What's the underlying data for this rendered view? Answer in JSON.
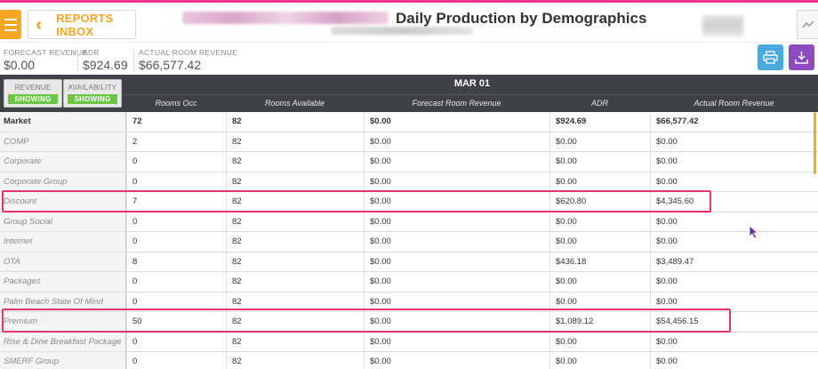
{
  "header": {
    "inbox_label": "REPORTS INBOX",
    "title": "Daily Production by Demographics"
  },
  "summary": {
    "stats": [
      {
        "label": "FORECAST REVENUE",
        "value": "$0.00"
      },
      {
        "label": "ADR",
        "value": "$924.69"
      },
      {
        "label": "ACTUAL ROOM REVENUE",
        "value": "$66,577.42"
      }
    ]
  },
  "toggles": [
    {
      "title": "REVENUE",
      "state": "SHOWING"
    },
    {
      "title": "AVAILABILITY",
      "state": "SHOWING"
    }
  ],
  "table": {
    "date": "MAR 01",
    "columns": [
      "Rooms Occ",
      "Rooms Available",
      "Forecast Room Revenue",
      "ADR",
      "Actual Room Revenue"
    ],
    "rows": [
      {
        "label": "Market",
        "values": [
          "72",
          "82",
          "$0.00",
          "$924.69",
          "$66,577.42"
        ]
      },
      {
        "label": "COMP",
        "values": [
          "2",
          "82",
          "$0.00",
          "$0.00",
          "$0.00"
        ]
      },
      {
        "label": "Corporate",
        "values": [
          "0",
          "82",
          "$0.00",
          "$0.00",
          "$0.00"
        ]
      },
      {
        "label": "Corporate Group",
        "values": [
          "0",
          "82",
          "$0.00",
          "$0.00",
          "$0.00"
        ]
      },
      {
        "label": "Discount",
        "values": [
          "7",
          "82",
          "$0.00",
          "$620.80",
          "$4,345.60"
        ]
      },
      {
        "label": "Group Social",
        "values": [
          "0",
          "82",
          "$0.00",
          "$0.00",
          "$0.00"
        ]
      },
      {
        "label": "Internet",
        "values": [
          "0",
          "82",
          "$0.00",
          "$0.00",
          "$0.00"
        ]
      },
      {
        "label": "OTA",
        "values": [
          "8",
          "82",
          "$0.00",
          "$436.18",
          "$3,489.47"
        ]
      },
      {
        "label": "Packages",
        "values": [
          "0",
          "82",
          "$0.00",
          "$0.00",
          "$0.00"
        ]
      },
      {
        "label": "Palm Beach State Of Mind",
        "values": [
          "0",
          "82",
          "$0.00",
          "$0.00",
          "$0.00"
        ]
      },
      {
        "label": "Premium",
        "values": [
          "50",
          "82",
          "$0.00",
          "$1,089.12",
          "$54,456.15"
        ]
      },
      {
        "label": "Rise & Dine Breakfast Package",
        "values": [
          "0",
          "82",
          "$0.00",
          "$0.00",
          "$0.00"
        ]
      },
      {
        "label": "SMERF Group",
        "values": [
          "0",
          "82",
          "$0.00",
          "$0.00",
          "$0.00"
        ]
      }
    ]
  },
  "colors": {
    "accent_orange": "#f5a623",
    "highlight_pink": "#e8336b",
    "header_dark": "#3e4247",
    "showing_green": "#6cc644",
    "print_blue": "#4aa8dc",
    "download_purple": "#8e4bbf"
  },
  "icons": [
    "hamburger-menu-icon",
    "double-chevron-left-icon",
    "trend-chart-icon",
    "printer-icon",
    "download-icon",
    "mouse-cursor-icon"
  ]
}
